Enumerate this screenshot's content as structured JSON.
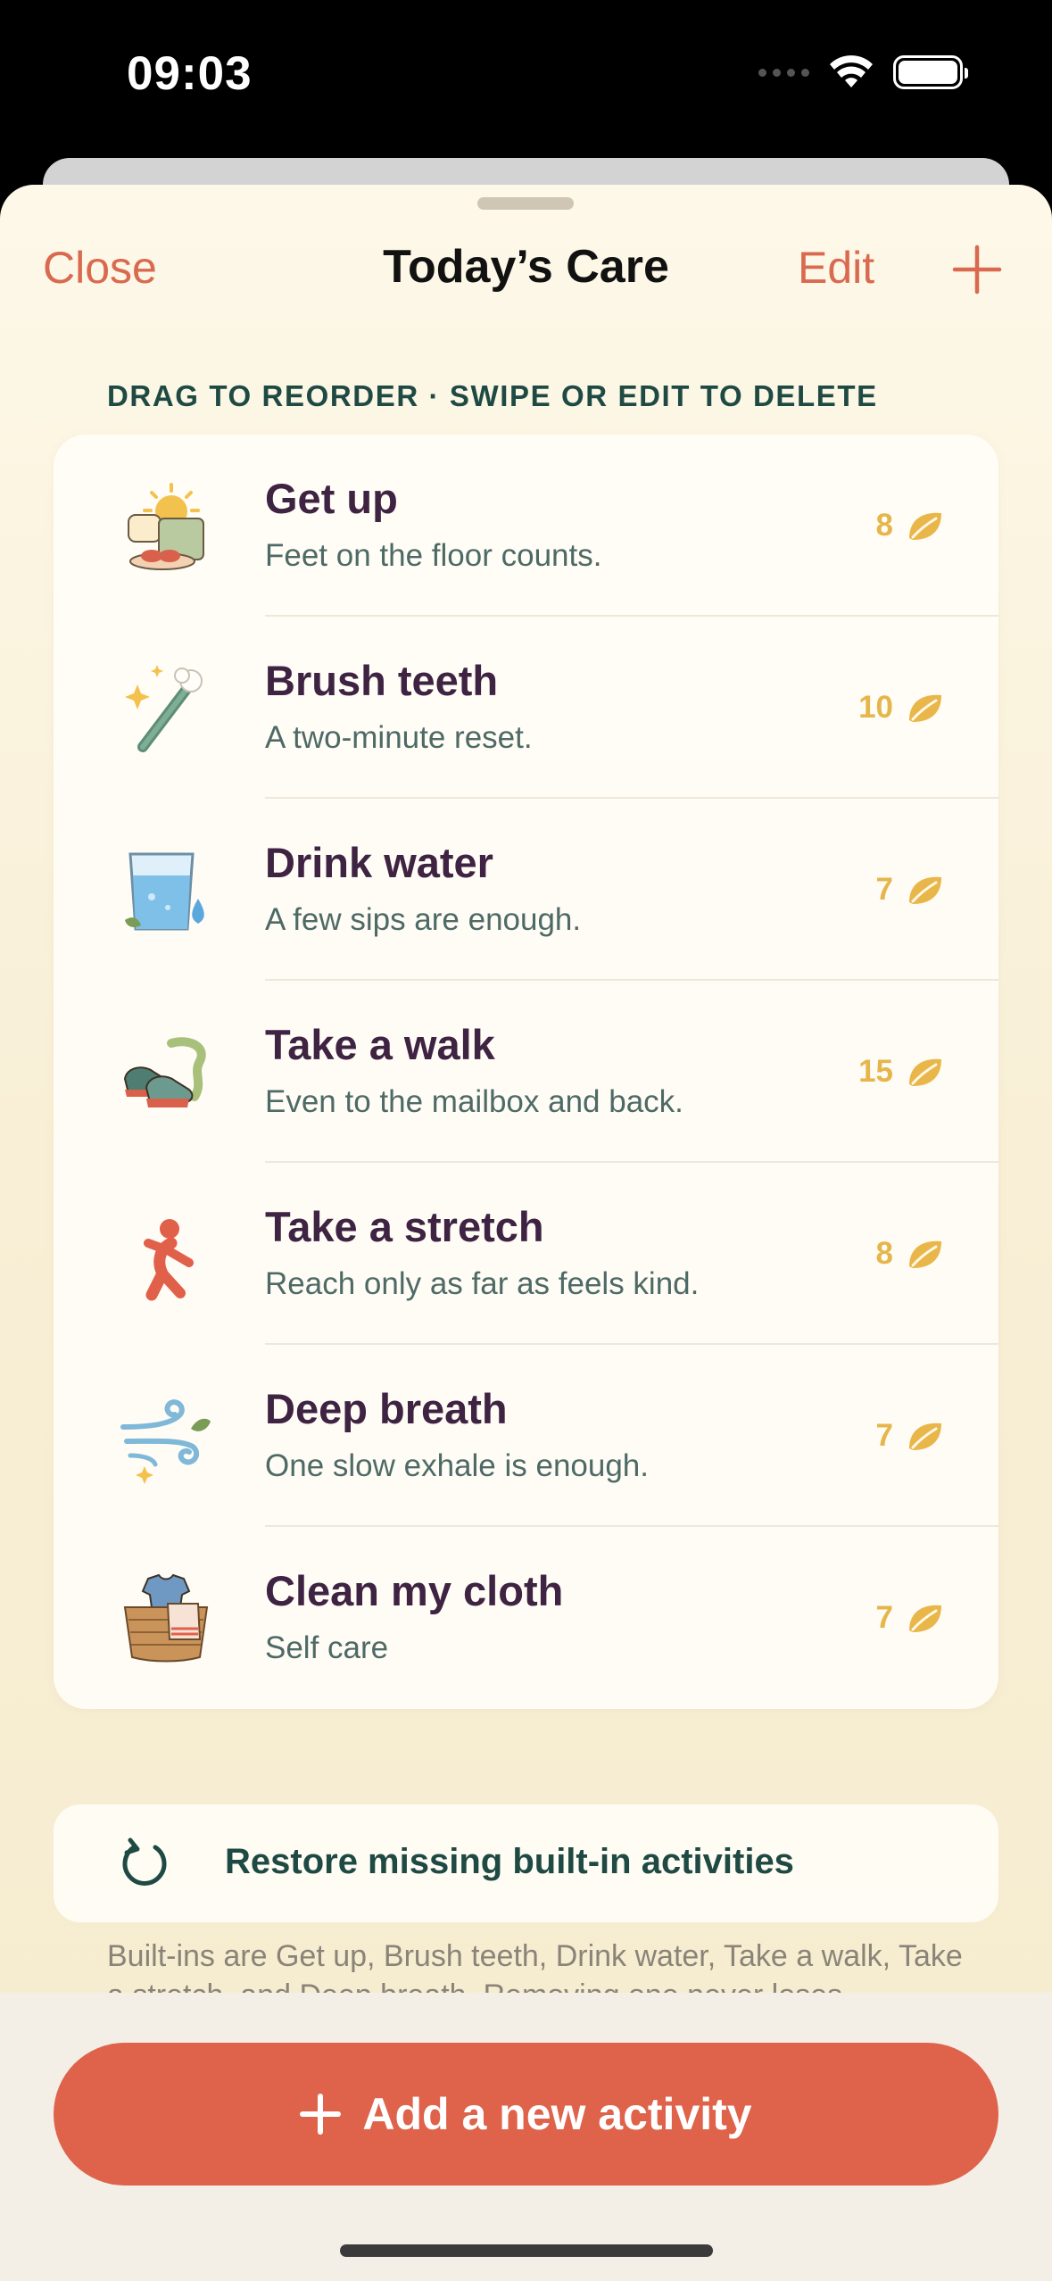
{
  "status_bar": {
    "time": "09:03"
  },
  "nav": {
    "close_label": "Close",
    "title": "Today’s Care",
    "edit_label": "Edit",
    "add_icon": "plus-icon"
  },
  "section_header": "DRAG TO REORDER · SWIPE OR EDIT TO DELETE",
  "activities": [
    {
      "title": "Get up",
      "subtitle": "Feet on the floor counts.",
      "points": "8",
      "icon": "bed-sunrise-icon"
    },
    {
      "title": "Brush teeth",
      "subtitle": "A two-minute reset.",
      "points": "10",
      "icon": "toothbrush-icon"
    },
    {
      "title": "Drink water",
      "subtitle": "A few sips are enough.",
      "points": "7",
      "icon": "water-glass-icon"
    },
    {
      "title": "Take a walk",
      "subtitle": "Even to the mailbox and back.",
      "points": "15",
      "icon": "sneakers-icon"
    },
    {
      "title": "Take a stretch",
      "subtitle": "Reach only as far as feels kind.",
      "points": "8",
      "icon": "stretch-figure-icon"
    },
    {
      "title": "Deep breath",
      "subtitle": "One slow exhale is enough.",
      "points": "7",
      "icon": "wind-breath-icon"
    },
    {
      "title": "Clean my cloth",
      "subtitle": "Self care",
      "points": "7",
      "icon": "laundry-basket-icon"
    }
  ],
  "restore": {
    "label": "Restore missing built-in activities",
    "icon": "restore-arrow-icon"
  },
  "footnote": "Built-ins are Get up, Brush teeth, Drink water, Take a walk, Take a stretch, and Deep breath. Removing one never loses",
  "add_button": {
    "label": "Add a new activity"
  },
  "colors": {
    "accent": "#df624b",
    "title_text": "#3e2342",
    "subtitle_text": "#4e6a66",
    "reward": "#e5b64b",
    "header_text": "#1f4a44"
  }
}
